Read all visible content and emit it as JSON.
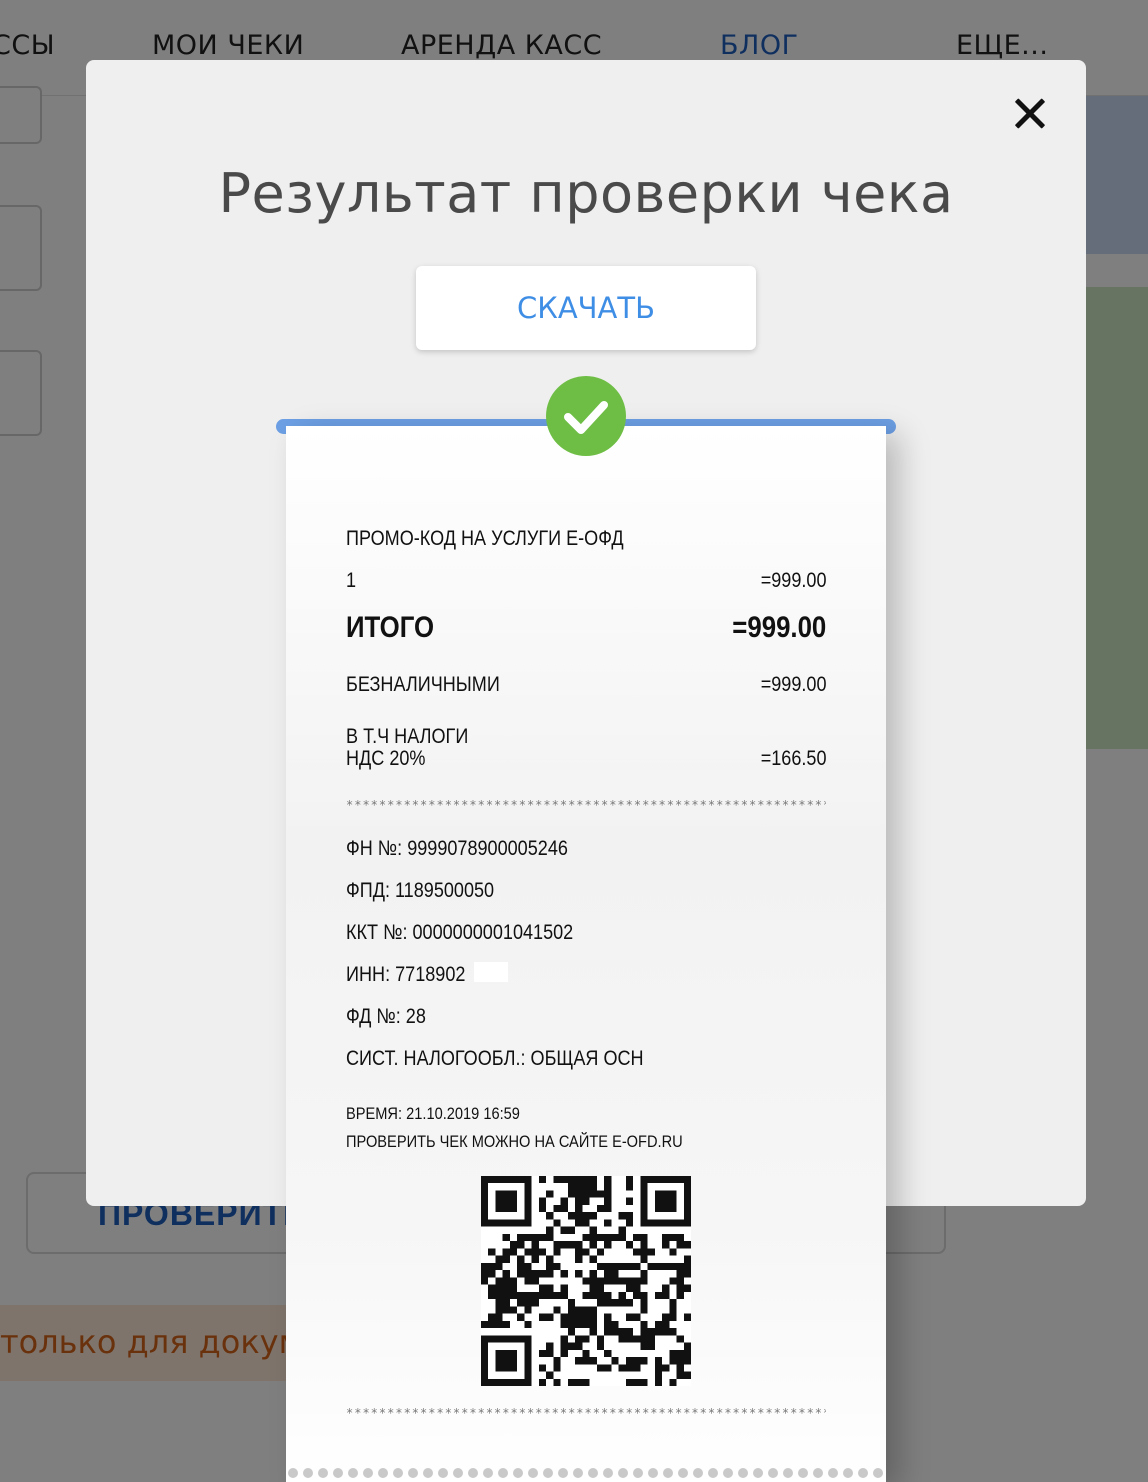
{
  "nav": {
    "items": [
      {
        "label": "ССЫ",
        "active": false
      },
      {
        "label": "МОИ ЧЕКИ",
        "active": false
      },
      {
        "label": "АРЕНДА КАСС",
        "active": false
      },
      {
        "label": "БЛОГ",
        "active": true
      },
      {
        "label": "ЕЩЕ...",
        "active": false
      }
    ]
  },
  "background": {
    "check_button_label": "ПРОВЕРИТЬ",
    "note_text": "только для докуме"
  },
  "modal": {
    "title": "Результат проверки чека",
    "download_label": "СКАЧАТЬ",
    "close_icon": "close-icon",
    "status_icon": "check-circle-icon"
  },
  "receipt": {
    "item_name": "ПРОМО-КОД НА УСЛУГИ Е-ОФД",
    "item_qty": "1",
    "item_price": "=999.00",
    "total_label": "ИТОГО",
    "total_value": "=999.00",
    "cashless_label": "БЕЗНАЛИЧНЫМИ",
    "cashless_value": "=999.00",
    "tax_label_line1": "В Т.Ч НАЛОГИ",
    "tax_label_line2": "НДС 20%",
    "tax_value": "=166.50",
    "separator": "****************************************************************",
    "fn": "ФН №: 9999078900005246",
    "fpd": "ФПД: 1189500050",
    "kkt": "ККТ №: 0000000001041502",
    "inn": "ИНН: 7718902",
    "fd": "ФД №: 28",
    "tax_system": "СИСТ. НАЛОГООБЛ.: ОБЩАЯ ОСН",
    "time": "ВРЕМЯ: 21.10.2019 16:59",
    "verify_note": "ПРОВЕРИТЬ ЧЕК МОЖНО НА САЙТЕ E-OFD.RU",
    "qr_icon": "qr-code"
  },
  "colors": {
    "accent_blue": "#3f8ee6",
    "nav_active": "#1f5fbf",
    "success_green": "#6ebe45",
    "receipt_bar": "#6c9fe4",
    "note_orange": "#d5631a"
  }
}
